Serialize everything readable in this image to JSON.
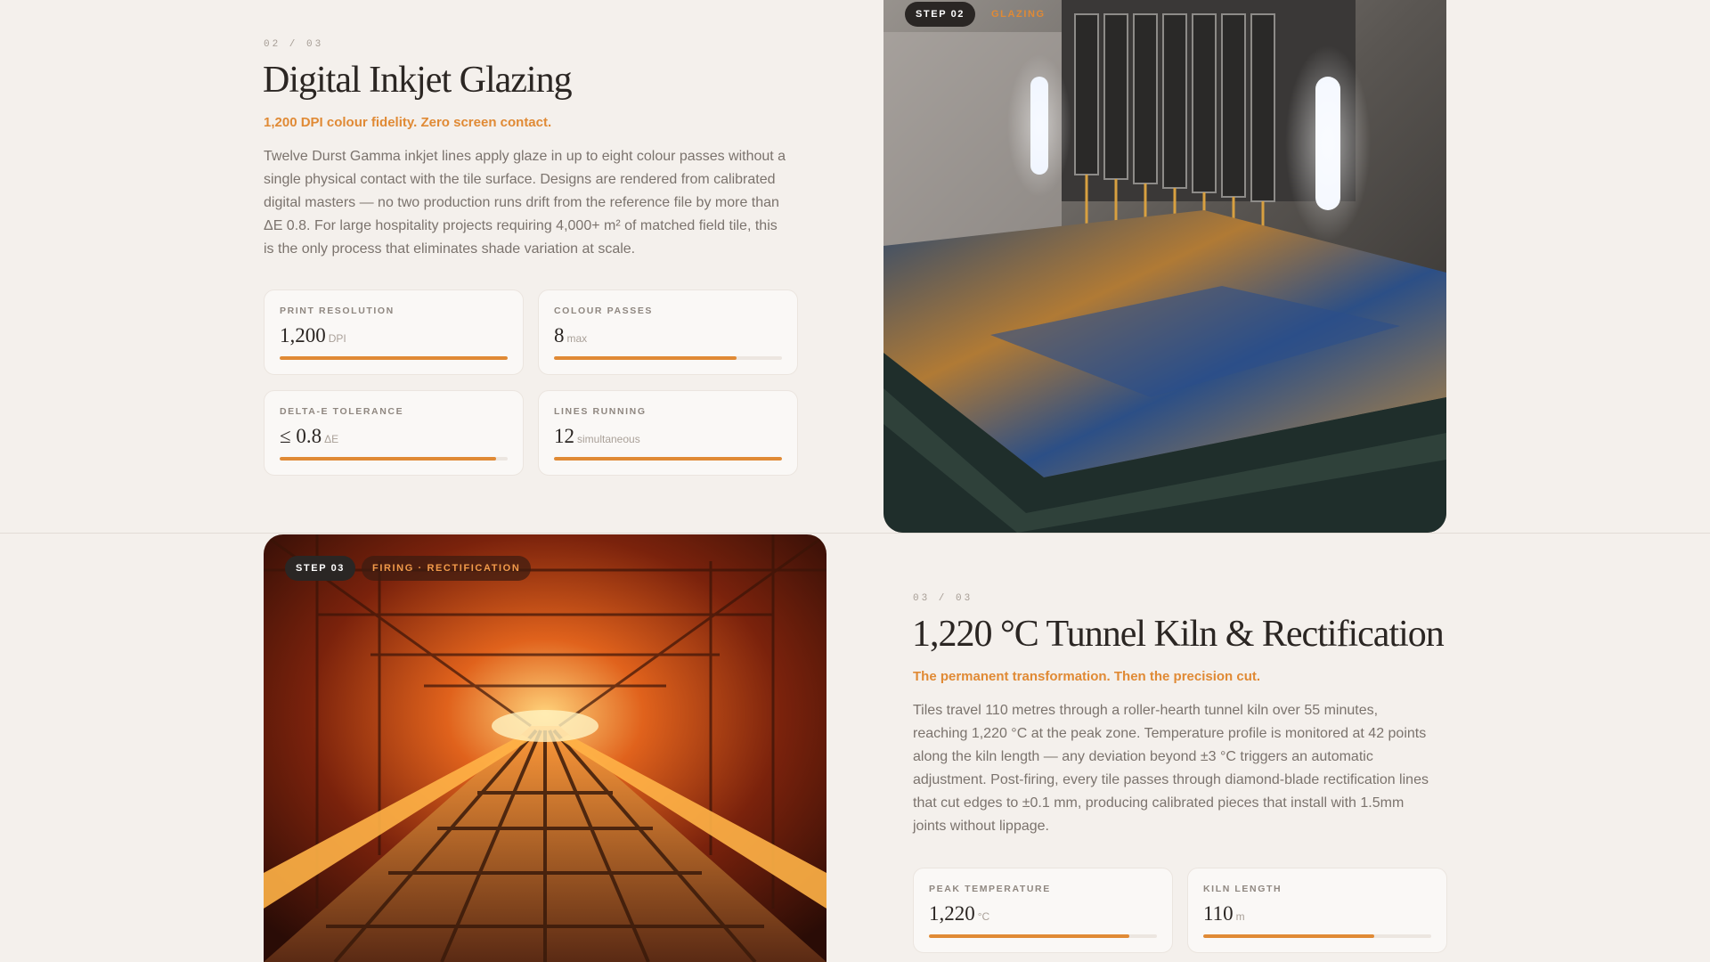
{
  "step2": {
    "counter": "02 / 03",
    "title": "Digital Inkjet Glazing",
    "subtitle": "1,200 DPI colour fidelity. Zero screen contact.",
    "body": "Twelve Durst Gamma inkjet lines apply glaze in up to eight colour passes without a single physical contact with the tile surface. Designs are rendered from calibrated digital masters — no two production runs drift from the reference file by more than ΔE 0.8. For large hospitality projects requiring 4,000+ m² of matched field tile, this is the only process that eliminates shade variation at scale.",
    "badge": "STEP 02",
    "tag": "GLAZING",
    "image_icon": "inkjet-printer-image",
    "stats": [
      {
        "label": "PRINT RESOLUTION",
        "value": "1,200",
        "unit": "DPI",
        "fill": 1.0
      },
      {
        "label": "COLOUR PASSES",
        "value": "8",
        "unit": "max",
        "fill": 0.8
      },
      {
        "label": "DELTA-E TOLERANCE",
        "value": "≤ 0.8",
        "unit": "ΔE",
        "fill": 0.95
      },
      {
        "label": "LINES RUNNING",
        "value": "12",
        "unit": "simultaneous",
        "fill": 1.0
      }
    ]
  },
  "step3": {
    "counter": "03 / 03",
    "title": "1,220 °C Tunnel Kiln & Rectification",
    "subtitle": "The permanent transformation. Then the precision cut.",
    "body": "Tiles travel 110 metres through a roller-hearth tunnel kiln over 55 minutes, reaching 1,220 °C at the peak zone. Temperature profile is monitored at 42 points along the kiln length — any deviation beyond ±3 °C triggers an automatic adjustment. Post-firing, every tile passes through diamond-blade rectification lines that cut edges to ±0.1 mm, producing calibrated pieces that install with 1.5mm joints without lippage.",
    "badge": "STEP 03",
    "tag": "FIRING · RECTIFICATION",
    "image_icon": "tunnel-kiln-image",
    "stats": [
      {
        "label": "PEAK TEMPERATURE",
        "value": "1,220",
        "unit": "°C",
        "fill": 0.88
      },
      {
        "label": "KILN LENGTH",
        "value": "110",
        "unit": "m",
        "fill": 0.75
      }
    ]
  },
  "colors": {
    "accent": "#e08a35",
    "background": "#f4f0ec",
    "badge": "#2a2624"
  }
}
